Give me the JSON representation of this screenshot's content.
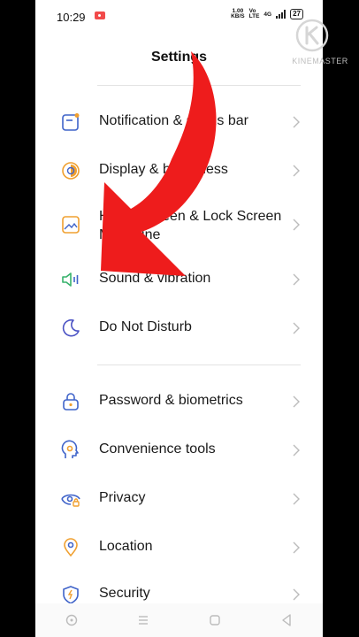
{
  "status_bar": {
    "time": "10:29",
    "net_speed_value": "1.00",
    "net_speed_unit": "KB/S",
    "volte_top": "Vo",
    "volte_bottom": "LTE",
    "signal": "4G",
    "battery": "27"
  },
  "header": {
    "title": "Settings"
  },
  "menu": {
    "items": [
      {
        "label": "Notification & status bar",
        "icon": "notification-icon"
      },
      {
        "label": "Display & brightness",
        "icon": "display-icon"
      },
      {
        "label_line1": "Home Screen & Lock Screen",
        "label_line2": "Magazine",
        "icon": "wallpaper-icon"
      },
      {
        "label": "Sound & vibration",
        "icon": "speaker-icon"
      },
      {
        "label": "Do Not Disturb",
        "icon": "moon-icon"
      },
      {
        "label": "Password & biometrics",
        "icon": "lock-icon"
      },
      {
        "label": "Convenience tools",
        "icon": "convenience-icon"
      },
      {
        "label": "Privacy",
        "icon": "privacy-icon"
      },
      {
        "label": "Location",
        "icon": "location-icon"
      },
      {
        "label": "Security",
        "icon": "security-icon"
      }
    ]
  },
  "watermark": {
    "text": "KINEMASTER"
  },
  "colors": {
    "arrow_red": "#ee1c1c",
    "icon_blue": "#3f63c9",
    "icon_orange": "#f0a030",
    "icon_green": "#37b26b",
    "icon_purple": "#4a52c4"
  }
}
